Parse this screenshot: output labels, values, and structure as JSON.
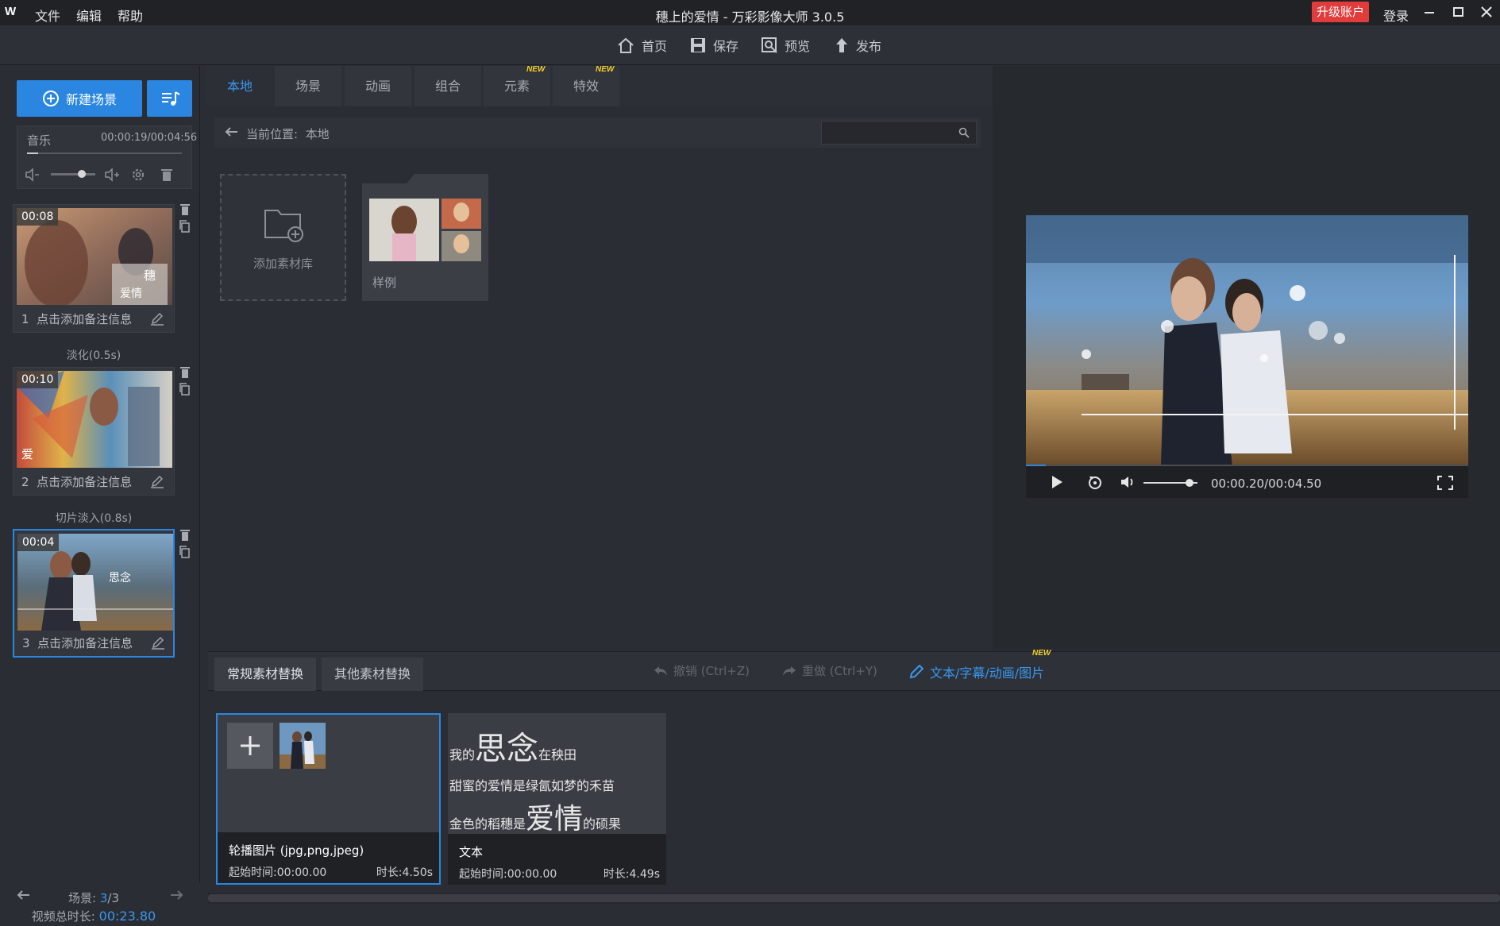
{
  "titlebar": {
    "logo": "W",
    "menus": [
      "文件",
      "编辑",
      "帮助"
    ],
    "title": "穗上的爱情 - 万彩影像大师 3.0.5",
    "upgrade": "升级账户",
    "login": "登录"
  },
  "toolbar": {
    "home": "首页",
    "save": "保存",
    "preview": "预览",
    "publish": "发布"
  },
  "left": {
    "new_scene": "新建场景",
    "music": {
      "label": "音乐",
      "time": "00:00:19/00:04:56",
      "progress": 0.07,
      "volume": 0.7
    },
    "scenes": [
      {
        "number": "1",
        "time": "00:08",
        "note": "点击添加备注信息",
        "overlay_text": "穗",
        "overlay_text2": "爱情"
      },
      {
        "number": "2",
        "time": "00:10",
        "note": "点击添加备注信息",
        "overlay_text": "爱"
      },
      {
        "number": "3",
        "time": "00:04",
        "note": "点击添加备注信息",
        "overlay_text": "思念"
      }
    ],
    "transitions": [
      "淡化(0.5s)",
      "切片淡入(0.8s)"
    ],
    "scene_count_label": "场景:",
    "scene_current": "3",
    "scene_total": "/3",
    "total_label": "视频总时长:",
    "total_value": "00:23.80"
  },
  "tabs": [
    {
      "label": "本地",
      "active": true,
      "new": false
    },
    {
      "label": "场景",
      "active": false,
      "new": false
    },
    {
      "label": "动画",
      "active": false,
      "new": false
    },
    {
      "label": "组合",
      "active": false,
      "new": false
    },
    {
      "label": "元素",
      "active": false,
      "new": true
    },
    {
      "label": "特效",
      "active": false,
      "new": true
    }
  ],
  "new_badge": "NEW",
  "path": {
    "label": "当前位置:",
    "value": "本地"
  },
  "search": {
    "placeholder": ""
  },
  "library": {
    "add_label": "添加素材库",
    "sample_label": "样例"
  },
  "player": {
    "time": "00:00.20/00:04.50",
    "progress": 0.045,
    "volume": 0.85
  },
  "bottom": {
    "tabs": [
      "常规素材替换",
      "其他素材替换"
    ],
    "undo": "撤销 (Ctrl+Z)",
    "redo": "重做 (Ctrl+Y)",
    "text_edit": "文本/字幕/动画/图片",
    "items": [
      {
        "type": "轮播图片 (jpg,png,jpeg)",
        "start": "起始时间:00:00.00",
        "duration": "时长:4.50s"
      },
      {
        "type": "文本",
        "start": "起始时间:00:00.00",
        "duration": "时长:4.49s"
      }
    ],
    "text_preview": {
      "line1_a": "我的",
      "line1_big": "思念",
      "line1_b": "在秧田",
      "line2": "甜蜜的爱情是绿氤如梦的禾苗",
      "line3_a": "金色的稻穗是",
      "line3_big": "爱情",
      "line3_b": "的硕果"
    }
  }
}
